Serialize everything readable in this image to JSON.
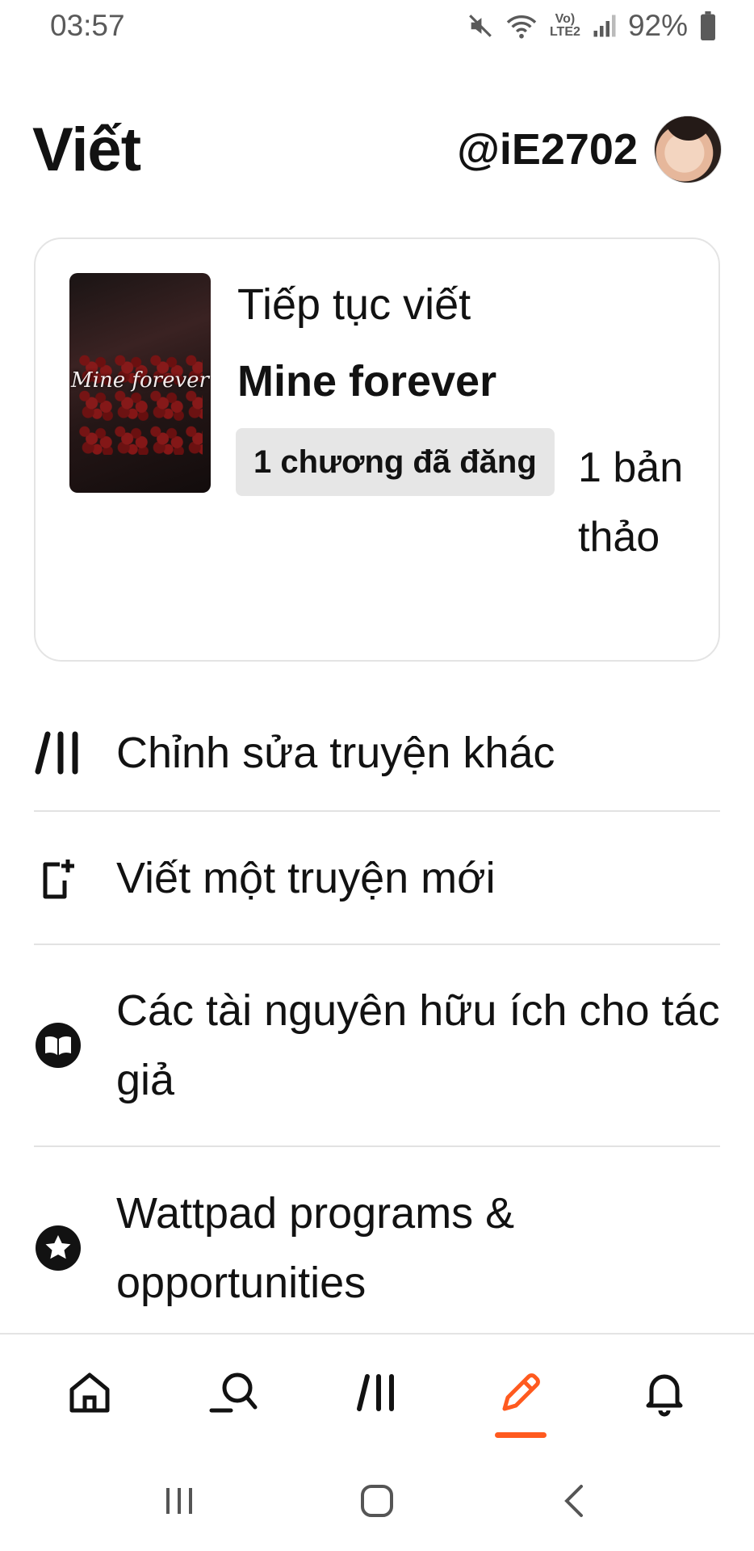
{
  "status_bar": {
    "time": "03:57",
    "network_label": "Vo) LTE2",
    "battery": "92%"
  },
  "header": {
    "title": "Viết",
    "username": "@iE2702"
  },
  "continue_card": {
    "label": "Tiếp tục viết",
    "story_title": "Mine forever",
    "cover_text": "Mine forever",
    "published_badge": "1 chương đã đăng",
    "drafts": "1 bản thảo"
  },
  "menu": {
    "items": [
      {
        "label": "Chỉnh sửa truyện khác",
        "icon": "library-slash-icon"
      },
      {
        "label": "Viết một truyện mới",
        "icon": "new-story-icon"
      },
      {
        "label": "Các tài nguyên hữu ích cho tác giả",
        "icon": "book-icon"
      },
      {
        "label": "Wattpad programs & opportunities",
        "icon": "star-icon"
      }
    ]
  },
  "bottom_nav": {
    "active": "write",
    "items": [
      "home-icon",
      "search-icon",
      "library-icon",
      "write-icon",
      "notifications-icon"
    ]
  },
  "colors": {
    "accent": "#ff5a1f",
    "text": "#121212",
    "divider": "#e2e2e2"
  }
}
